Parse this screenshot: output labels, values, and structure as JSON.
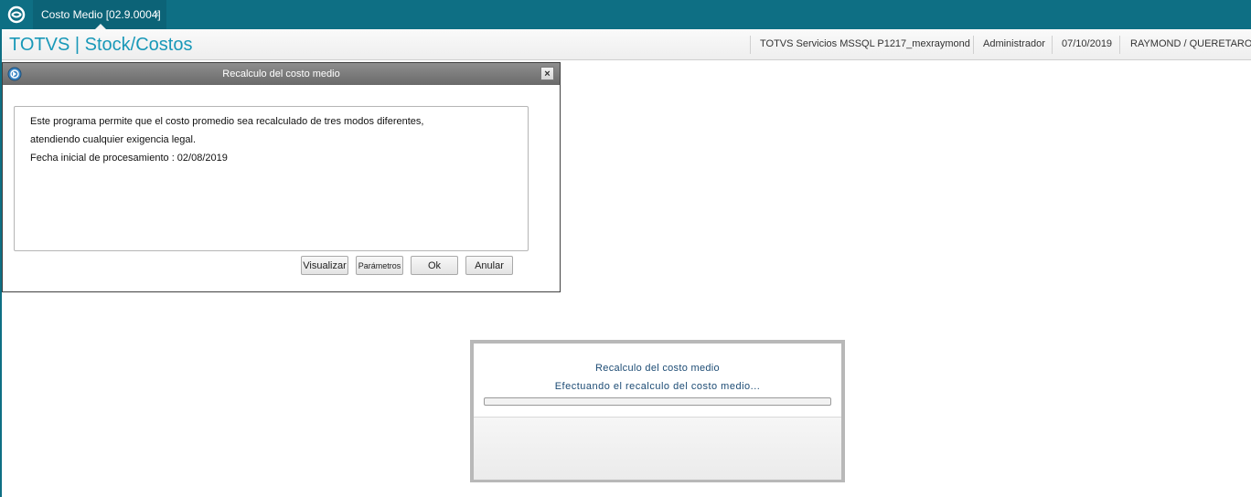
{
  "tab": {
    "label": "Costo Medio [02.9.0004]",
    "close": "×"
  },
  "header": {
    "title": "TOTVS | Stock/Costos",
    "environment": "TOTVS Servicios MSSQL P1217_mexraymond",
    "user": "Administrador",
    "date": "07/10/2019",
    "branch": "RAYMOND / QUERETARO"
  },
  "dialog": {
    "title": "Recalculo del costo medio",
    "close": "×",
    "lines": [
      "Este programa permite que el costo promedio sea recalculado de tres modos diferentes,",
      "atendiendo cualquier exigencia legal.",
      "Fecha inicial de procesamiento : 02/08/2019"
    ],
    "buttons": {
      "visualizar": "Visualizar",
      "parametros": "Parámetros",
      "ok": "Ok",
      "anular": "Anular"
    }
  },
  "progress": {
    "title": "Recalculo del costo medio",
    "message": "Efectuando el recalculo del costo medio...",
    "value": 0
  },
  "colors": {
    "topbar": "#0e6f84",
    "title_accent": "#1998b8",
    "progress_text": "#1c4b74"
  },
  "icons": {
    "logo": "totvs-logo-icon",
    "dialog": "app-icon"
  }
}
